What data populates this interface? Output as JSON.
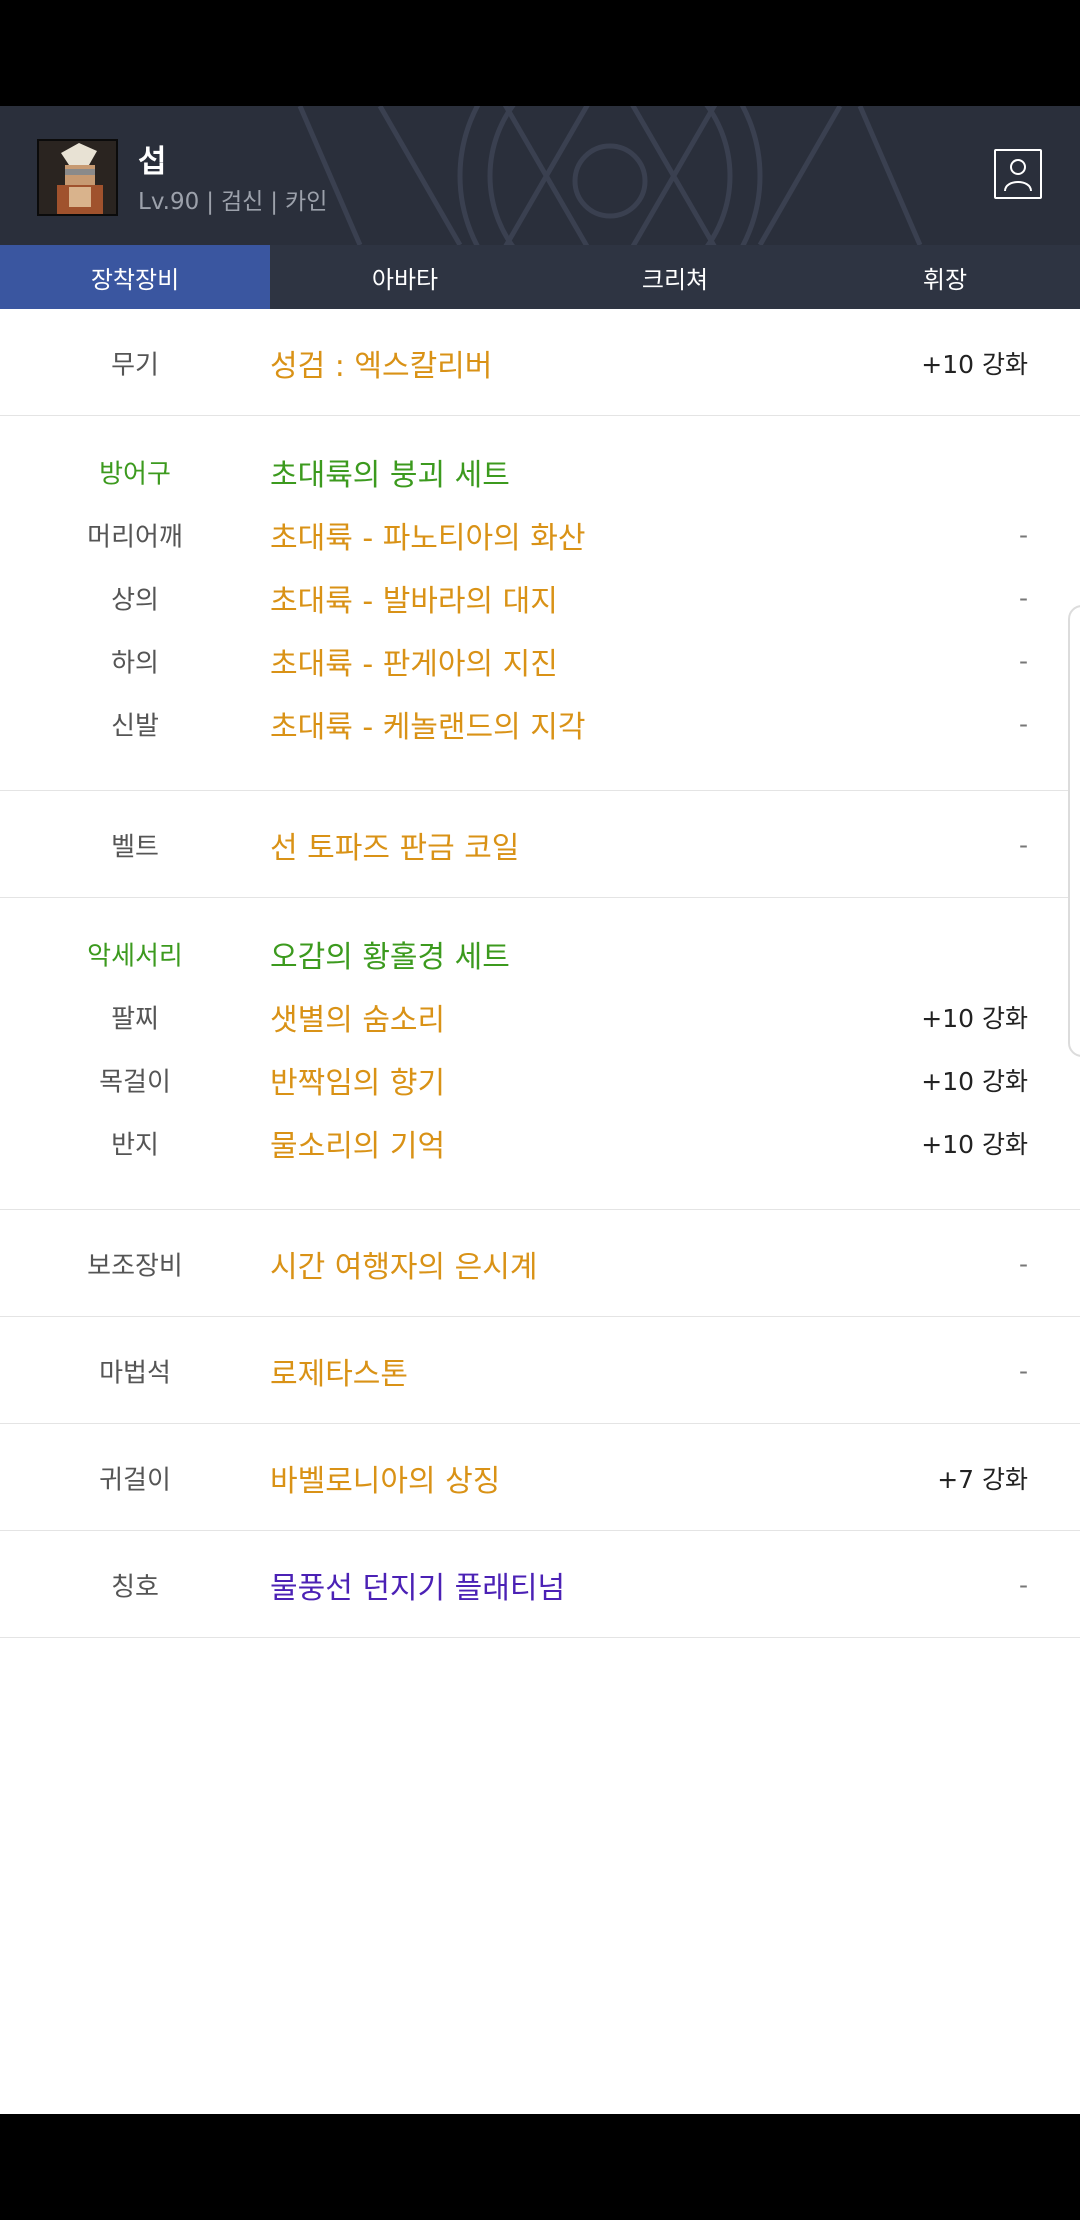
{
  "character": {
    "name": "섭",
    "level": "Lv.90",
    "job": "검신",
    "server": "카인",
    "separator": "|"
  },
  "tabs": [
    {
      "label": "장착장비",
      "active": true
    },
    {
      "label": "아바타",
      "active": false
    },
    {
      "label": "크리쳐",
      "active": false
    },
    {
      "label": "휘장",
      "active": false
    }
  ],
  "equipment": {
    "weapon": {
      "slot": "무기",
      "item": "성검 : 엑스칼리버",
      "enhance": "+10 강화"
    },
    "armor_set": {
      "slot": "방어구",
      "set_name": "초대륙의 붕괴 세트",
      "items": [
        {
          "slot": "머리어깨",
          "item": "초대륙 - 파노티아의 화산",
          "enhance": "-"
        },
        {
          "slot": "상의",
          "item": "초대륙 - 발바라의 대지",
          "enhance": "-"
        },
        {
          "slot": "하의",
          "item": "초대륙 - 판게아의 지진",
          "enhance": "-"
        },
        {
          "slot": "신발",
          "item": "초대륙 - 케놀랜드의 지각",
          "enhance": "-"
        }
      ]
    },
    "belt": {
      "slot": "벨트",
      "item": "선 토파즈 판금 코일",
      "enhance": "-"
    },
    "accessory_set": {
      "slot": "악세서리",
      "set_name": "오감의 황홀경 세트",
      "items": [
        {
          "slot": "팔찌",
          "item": "샛별의 숨소리",
          "enhance": "+10 강화"
        },
        {
          "slot": "목걸이",
          "item": "반짝임의 향기",
          "enhance": "+10 강화"
        },
        {
          "slot": "반지",
          "item": "물소리의 기억",
          "enhance": "+10 강화"
        }
      ]
    },
    "subweapon": {
      "slot": "보조장비",
      "item": "시간 여행자의 은시계",
      "enhance": "-"
    },
    "magicstone": {
      "slot": "마법석",
      "item": "로제타스톤",
      "enhance": "-"
    },
    "earring": {
      "slot": "귀걸이",
      "item": "바벨로니아의 상징",
      "enhance": "+7 강화"
    },
    "title": {
      "slot": "칭호",
      "item": "물풍선 던지기 플래티넘",
      "enhance": "-"
    }
  },
  "colors": {
    "item_orange": "#d99216",
    "set_green": "#3c9a1e",
    "title_purple": "#4b21b5",
    "active_tab": "#3a56a0",
    "header_bg": "#2a2f3b"
  }
}
